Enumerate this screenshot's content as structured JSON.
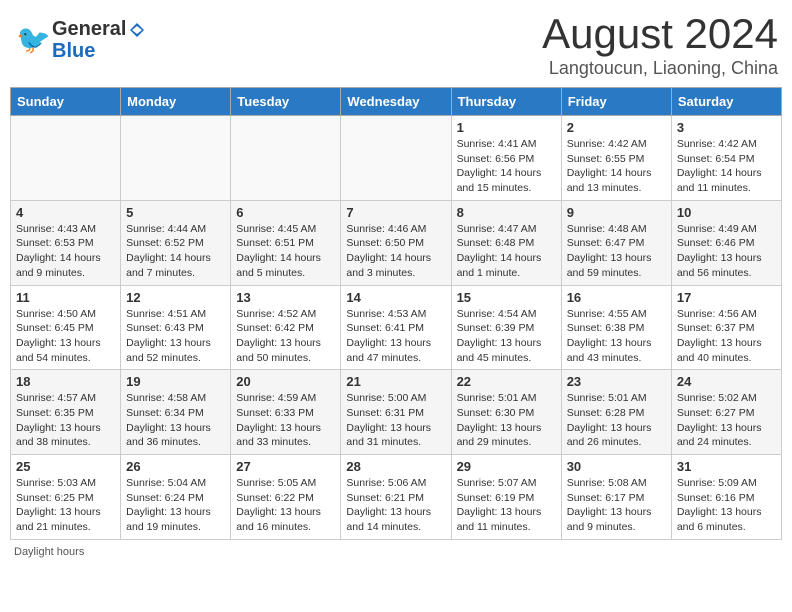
{
  "header": {
    "logo_general": "General",
    "logo_blue": "Blue",
    "month_title": "August 2024",
    "location": "Langtoucun, Liaoning, China"
  },
  "days_of_week": [
    "Sunday",
    "Monday",
    "Tuesday",
    "Wednesday",
    "Thursday",
    "Friday",
    "Saturday"
  ],
  "weeks": [
    [
      {
        "day": "",
        "info": ""
      },
      {
        "day": "",
        "info": ""
      },
      {
        "day": "",
        "info": ""
      },
      {
        "day": "",
        "info": ""
      },
      {
        "day": "1",
        "info": "Sunrise: 4:41 AM\nSunset: 6:56 PM\nDaylight: 14 hours and 15 minutes."
      },
      {
        "day": "2",
        "info": "Sunrise: 4:42 AM\nSunset: 6:55 PM\nDaylight: 14 hours and 13 minutes."
      },
      {
        "day": "3",
        "info": "Sunrise: 4:42 AM\nSunset: 6:54 PM\nDaylight: 14 hours and 11 minutes."
      }
    ],
    [
      {
        "day": "4",
        "info": "Sunrise: 4:43 AM\nSunset: 6:53 PM\nDaylight: 14 hours and 9 minutes."
      },
      {
        "day": "5",
        "info": "Sunrise: 4:44 AM\nSunset: 6:52 PM\nDaylight: 14 hours and 7 minutes."
      },
      {
        "day": "6",
        "info": "Sunrise: 4:45 AM\nSunset: 6:51 PM\nDaylight: 14 hours and 5 minutes."
      },
      {
        "day": "7",
        "info": "Sunrise: 4:46 AM\nSunset: 6:50 PM\nDaylight: 14 hours and 3 minutes."
      },
      {
        "day": "8",
        "info": "Sunrise: 4:47 AM\nSunset: 6:48 PM\nDaylight: 14 hours and 1 minute."
      },
      {
        "day": "9",
        "info": "Sunrise: 4:48 AM\nSunset: 6:47 PM\nDaylight: 13 hours and 59 minutes."
      },
      {
        "day": "10",
        "info": "Sunrise: 4:49 AM\nSunset: 6:46 PM\nDaylight: 13 hours and 56 minutes."
      }
    ],
    [
      {
        "day": "11",
        "info": "Sunrise: 4:50 AM\nSunset: 6:45 PM\nDaylight: 13 hours and 54 minutes."
      },
      {
        "day": "12",
        "info": "Sunrise: 4:51 AM\nSunset: 6:43 PM\nDaylight: 13 hours and 52 minutes."
      },
      {
        "day": "13",
        "info": "Sunrise: 4:52 AM\nSunset: 6:42 PM\nDaylight: 13 hours and 50 minutes."
      },
      {
        "day": "14",
        "info": "Sunrise: 4:53 AM\nSunset: 6:41 PM\nDaylight: 13 hours and 47 minutes."
      },
      {
        "day": "15",
        "info": "Sunrise: 4:54 AM\nSunset: 6:39 PM\nDaylight: 13 hours and 45 minutes."
      },
      {
        "day": "16",
        "info": "Sunrise: 4:55 AM\nSunset: 6:38 PM\nDaylight: 13 hours and 43 minutes."
      },
      {
        "day": "17",
        "info": "Sunrise: 4:56 AM\nSunset: 6:37 PM\nDaylight: 13 hours and 40 minutes."
      }
    ],
    [
      {
        "day": "18",
        "info": "Sunrise: 4:57 AM\nSunset: 6:35 PM\nDaylight: 13 hours and 38 minutes."
      },
      {
        "day": "19",
        "info": "Sunrise: 4:58 AM\nSunset: 6:34 PM\nDaylight: 13 hours and 36 minutes."
      },
      {
        "day": "20",
        "info": "Sunrise: 4:59 AM\nSunset: 6:33 PM\nDaylight: 13 hours and 33 minutes."
      },
      {
        "day": "21",
        "info": "Sunrise: 5:00 AM\nSunset: 6:31 PM\nDaylight: 13 hours and 31 minutes."
      },
      {
        "day": "22",
        "info": "Sunrise: 5:01 AM\nSunset: 6:30 PM\nDaylight: 13 hours and 29 minutes."
      },
      {
        "day": "23",
        "info": "Sunrise: 5:01 AM\nSunset: 6:28 PM\nDaylight: 13 hours and 26 minutes."
      },
      {
        "day": "24",
        "info": "Sunrise: 5:02 AM\nSunset: 6:27 PM\nDaylight: 13 hours and 24 minutes."
      }
    ],
    [
      {
        "day": "25",
        "info": "Sunrise: 5:03 AM\nSunset: 6:25 PM\nDaylight: 13 hours and 21 minutes."
      },
      {
        "day": "26",
        "info": "Sunrise: 5:04 AM\nSunset: 6:24 PM\nDaylight: 13 hours and 19 minutes."
      },
      {
        "day": "27",
        "info": "Sunrise: 5:05 AM\nSunset: 6:22 PM\nDaylight: 13 hours and 16 minutes."
      },
      {
        "day": "28",
        "info": "Sunrise: 5:06 AM\nSunset: 6:21 PM\nDaylight: 13 hours and 14 minutes."
      },
      {
        "day": "29",
        "info": "Sunrise: 5:07 AM\nSunset: 6:19 PM\nDaylight: 13 hours and 11 minutes."
      },
      {
        "day": "30",
        "info": "Sunrise: 5:08 AM\nSunset: 6:17 PM\nDaylight: 13 hours and 9 minutes."
      },
      {
        "day": "31",
        "info": "Sunrise: 5:09 AM\nSunset: 6:16 PM\nDaylight: 13 hours and 6 minutes."
      }
    ]
  ],
  "footer": {
    "daylight_label": "Daylight hours"
  }
}
